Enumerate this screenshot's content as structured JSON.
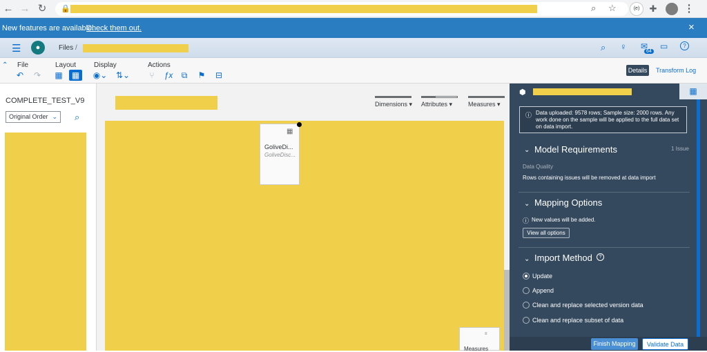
{
  "browser": {
    "icons": {
      "back": "back-arrow-icon",
      "forward": "forward-arrow-icon",
      "reload": "reload-icon",
      "lock": "lock-icon",
      "zoom": "zoom-icon",
      "star": "bookmark-star-icon",
      "extension": "extension-icon",
      "puzzle": "puzzle-icon",
      "avatar": "profile-avatar",
      "menu": "kebab-menu-icon"
    },
    "extension_badge": "(e)"
  },
  "banner": {
    "text": "New features are available.",
    "link": "Check them out.",
    "close": "×"
  },
  "shell": {
    "breadcrumb_root": "Files",
    "breadcrumb_sep": "/",
    "notification_count": "64"
  },
  "toolbar": {
    "groups": {
      "file": "File",
      "layout": "Layout",
      "display": "Display",
      "actions": "Actions"
    },
    "details_label": "Details",
    "transform_log_label": "Transform Log"
  },
  "left_panel": {
    "title": "COMPLETE_TEST_V9",
    "sort_value": "Original Order"
  },
  "main": {
    "filters": {
      "dimensions": "Dimensions",
      "attributes": "Attributes",
      "measures": "Measures"
    },
    "card": {
      "title": "GoliveDi...",
      "subtitle": "GoliveDisc..."
    },
    "measures_card": {
      "title": "Measures"
    }
  },
  "right_panel": {
    "info_text": "Data uploaded: 9578 rows; Sample size: 2000 rows. Any work done on the sample will be applied to the full data set on data import.",
    "model_requirements": {
      "title": "Model Requirements",
      "count": "1 Issue",
      "sub_label": "Data Quality",
      "message": "Rows containing issues will be removed at data import"
    },
    "mapping_options": {
      "title": "Mapping Options",
      "note": "New values will be added.",
      "button": "View all options"
    },
    "import_method": {
      "title": "Import Method",
      "options": [
        "Update",
        "Append",
        "Clean and replace selected version data",
        "Clean and replace subset of data"
      ],
      "selected": "Update"
    },
    "finish_button": "Finish Mapping",
    "validate_button": "Validate Data"
  },
  "colors": {
    "accent": "#0a6ed1",
    "banner": "#2b7dc1",
    "panel": "#34495e",
    "redacted": "#f0d04b"
  }
}
